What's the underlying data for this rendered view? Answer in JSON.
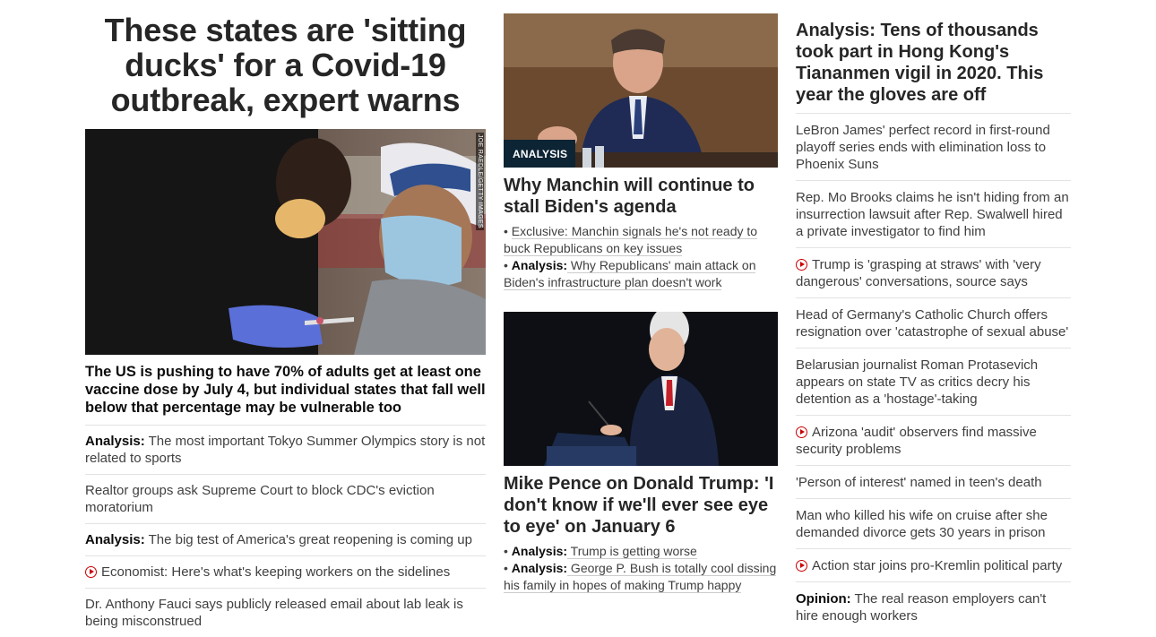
{
  "col1": {
    "headline": "These states are 'sitting ducks' for a Covid-19 outbreak, expert warns",
    "credit": "JOE RAEDLE/GETTY IMAGES",
    "subhead": "The US is pushing to have 70% of adults get at least one vaccine dose by July 4, but individual states that fall well below that percentage may be vulnerable too",
    "items": [
      {
        "prefix": "Analysis:",
        "text": " The most important Tokyo Summer Olympics story is not related to sports"
      },
      {
        "prefix": "",
        "text": "Realtor groups ask Supreme Court to block CDC's eviction moratorium"
      },
      {
        "prefix": "Analysis:",
        "text": " The big test of America's great reopening is coming up"
      },
      {
        "prefix": "",
        "text": "Economist: Here's what's keeping workers on the sidelines",
        "video": true
      },
      {
        "prefix": "",
        "text": "Dr. Anthony Fauci says publicly released email about lab leak is being misconstrued"
      }
    ]
  },
  "col2": {
    "card1": {
      "label": "ANALYSIS",
      "title": "Why Manchin will continue to stall Biden's agenda",
      "bullets": [
        {
          "prefix": "",
          "text": "Exclusive: Manchin signals he's not ready to buck Republicans on key issues"
        },
        {
          "prefix": "Analysis:",
          "text": " Why Republicans' main attack on Biden's infrastructure plan doesn't work"
        }
      ]
    },
    "card2": {
      "title": "Mike Pence on Donald Trump: 'I don't know if we'll ever see eye to eye' on January 6",
      "bullets": [
        {
          "prefix": "Analysis:",
          "text": " Trump is getting worse"
        },
        {
          "prefix": "Analysis:",
          "text": " George P. Bush is totally cool dissing his family in hopes of making Trump happy"
        }
      ]
    }
  },
  "col3": {
    "headline": "Analysis: Tens of thousands took part in Hong Kong's Tiananmen vigil in 2020. This year the gloves are off",
    "items": [
      {
        "prefix": "",
        "text": "LeBron James' perfect record in first-round playoff series ends with elimination loss to Phoenix Suns"
      },
      {
        "prefix": "",
        "text": "Rep. Mo Brooks claims he isn't hiding from an insurrection lawsuit after Rep. Swalwell hired a private investigator to find him"
      },
      {
        "prefix": "",
        "text": "Trump is 'grasping at straws' with 'very dangerous' conversations, source says",
        "video": true
      },
      {
        "prefix": "",
        "text": "Head of Germany's Catholic Church offers resignation over 'catastrophe of sexual abuse'"
      },
      {
        "prefix": "",
        "text": "Belarusian journalist Roman Protasevich appears on state TV as critics decry his detention as a 'hostage'-taking"
      },
      {
        "prefix": "",
        "text": "Arizona 'audit' observers find massive security problems",
        "video": true
      },
      {
        "prefix": "",
        "text": "'Person of interest' named in teen's death"
      },
      {
        "prefix": "",
        "text": "Man who killed his wife on cruise after she demanded divorce gets 30 years in prison"
      },
      {
        "prefix": "",
        "text": "Action star joins pro-Kremlin political party",
        "video": true
      },
      {
        "prefix": "Opinion:",
        "text": " The real reason employers can't hire enough workers"
      }
    ]
  }
}
